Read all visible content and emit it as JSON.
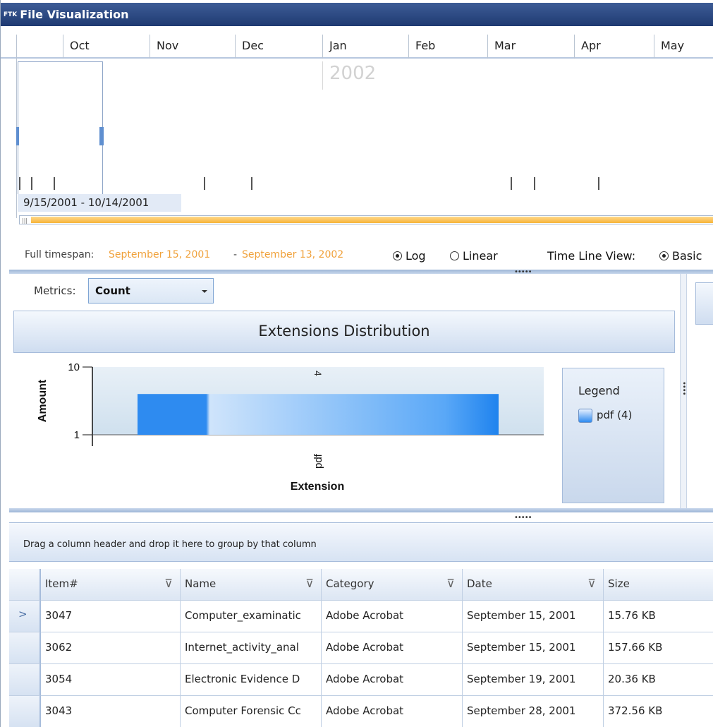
{
  "window": {
    "logo": "FTK",
    "title": "File Visualization"
  },
  "timeline": {
    "months": [
      "Oct",
      "Nov",
      "Dec",
      "Jan",
      "Feb",
      "Mar",
      "Apr",
      "May"
    ],
    "year": "2002",
    "selected_range": "9/15/2001 - 10/14/2001"
  },
  "options": {
    "full_timespan_label": "Full timespan:",
    "start": "September 15, 2001",
    "separator": "-",
    "end": "September 13, 2002",
    "scale_options": [
      "Log",
      "Linear"
    ],
    "scale_selected": "Log",
    "timeline_view_label": "Time Line View:",
    "timeline_view_value": "Basic"
  },
  "metrics": {
    "label": "Metrics:",
    "value": "Count"
  },
  "chart": {
    "panel_title": "Extensions Distribution",
    "legend_title": "Legend",
    "legend_item": "pdf (4)"
  },
  "chart_data": {
    "type": "bar",
    "title": "Extensions Distribution",
    "xlabel": "Extension",
    "ylabel": "Amount",
    "categories": [
      "pdf"
    ],
    "values": [
      4
    ],
    "data_labels": [
      "4"
    ],
    "y_scale": "log",
    "ylim": [
      1,
      10
    ],
    "y_ticks": [
      "10",
      "1"
    ],
    "legend": [
      "pdf (4)"
    ],
    "legend_position": "right",
    "colors": {
      "bar": "#2e8bf0"
    }
  },
  "grid": {
    "group_hint": "Drag a column header and drop it here to group by that column",
    "columns": [
      "Item#",
      "Name",
      "Category",
      "Date",
      "Size"
    ],
    "rows": [
      [
        "3047",
        "Computer_examinatic",
        "Adobe Acrobat",
        "September 15, 2001",
        "15.76 KB"
      ],
      [
        "3062",
        "Internet_activity_anal",
        "Adobe Acrobat",
        "September 15, 2001",
        "157.66 KB"
      ],
      [
        "3054",
        "Electronic Evidence D",
        "Adobe Acrobat",
        "September 19, 2001",
        "20.36 KB"
      ],
      [
        "3043",
        "Computer Forensic Cc",
        "Adobe Acrobat",
        "September 28, 2001",
        "372.56 KB"
      ]
    ],
    "current_row_marker": ">"
  }
}
